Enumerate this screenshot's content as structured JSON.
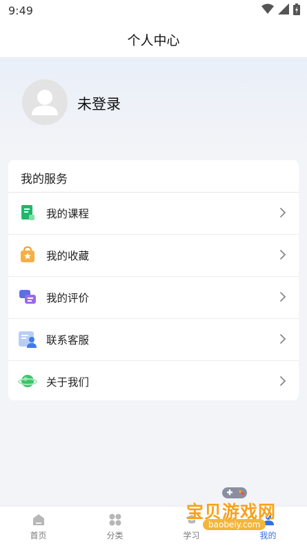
{
  "status_bar": {
    "time": "9:49"
  },
  "header": {
    "title": "个人中心"
  },
  "profile": {
    "login_text": "未登录"
  },
  "services": {
    "title": "我的服务",
    "items": [
      {
        "label": "我的课程",
        "icon": "book-icon"
      },
      {
        "label": "我的收藏",
        "icon": "favorites-bag-icon"
      },
      {
        "label": "我的评价",
        "icon": "comment-bubbles-icon"
      },
      {
        "label": "联系客服",
        "icon": "customer-service-icon"
      },
      {
        "label": "关于我们",
        "icon": "planet-icon"
      }
    ]
  },
  "tabbar": {
    "tabs": [
      {
        "label": "首页",
        "icon": "home-icon"
      },
      {
        "label": "分类",
        "icon": "category-icon"
      },
      {
        "label": "学习",
        "icon": "study-icon"
      },
      {
        "label": "我的",
        "icon": "profile-icon",
        "active": true
      }
    ]
  },
  "watermark": {
    "text": "宝贝游戏网",
    "url": "baobeiy.com"
  },
  "colors": {
    "accent": "#2f6fe5",
    "background": "#f3f4f7"
  }
}
